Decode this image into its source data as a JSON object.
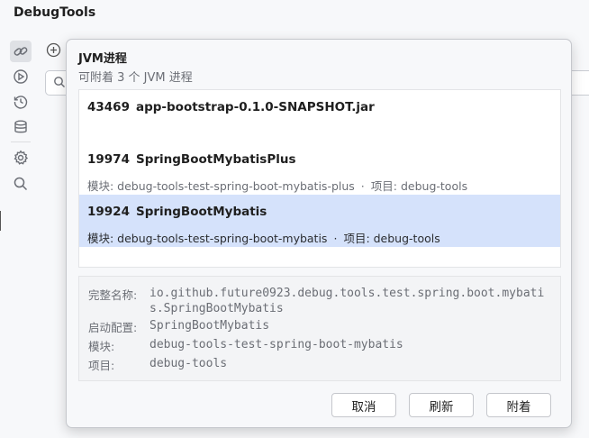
{
  "app": {
    "title": "DebugTools"
  },
  "rail": {
    "icons": [
      "link-icon",
      "play-circle-icon",
      "history-icon",
      "database-icon",
      "gear-icon",
      "search-icon"
    ]
  },
  "popup": {
    "title": "JVM进程",
    "subtitle": "可附着 3 个 JVM 进程",
    "processes": [
      {
        "pid": "43469",
        "name": "app-bootstrap-0.1.0-SNAPSHOT.jar",
        "module": "",
        "project": ""
      },
      {
        "pid": "19974",
        "name": "SpringBootMybatisPlus",
        "module": "模块: debug-tools-test-spring-boot-mybatis-plus",
        "project": "项目: debug-tools"
      },
      {
        "pid": "19924",
        "name": "SpringBootMybatis",
        "module": "模块: debug-tools-test-spring-boot-mybatis",
        "project": "项目: debug-tools"
      }
    ],
    "separator": "·",
    "details": {
      "fullname_label": "完整名称:",
      "fullname_value": "io.github.future0923.debug.tools.test.spring.boot.mybatis.SpringBootMybatis",
      "run_config_label": "启动配置:",
      "run_config_value": "SpringBootMybatis",
      "module_label": "模块:",
      "module_value": "debug-tools-test-spring-boot-mybatis",
      "project_label": "项目:",
      "project_value": "debug-tools"
    },
    "buttons": {
      "cancel": "取消",
      "refresh": "刷新",
      "attach": "附着"
    }
  },
  "colors": {
    "selection": "#d5e2fb",
    "muted_text": "#6b6e75"
  }
}
